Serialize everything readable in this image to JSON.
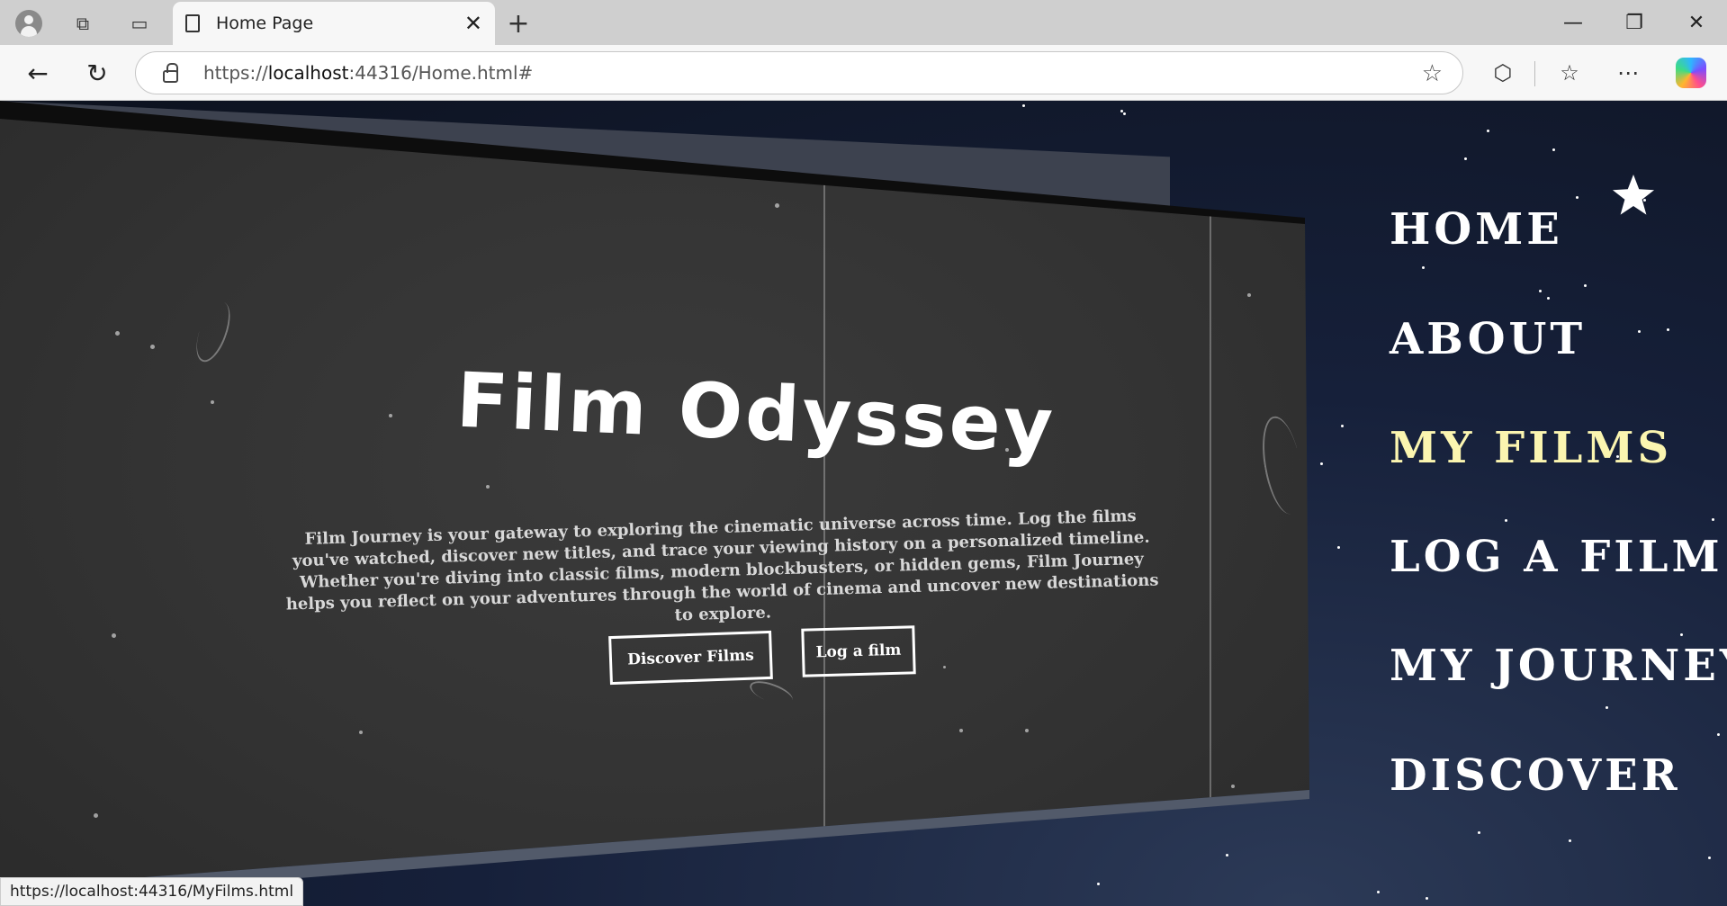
{
  "browser": {
    "tab_title": "Home Page",
    "url_prefix": "https://",
    "url_host": "localhost",
    "url_rest": ":44316/Home.html#",
    "status_url": "https://localhost:44316/MyFilms.html"
  },
  "hero": {
    "title": "Film Odyssey",
    "description": "Film Journey is your gateway to exploring the cinematic universe across time. Log the films you've watched, discover new titles, and trace your viewing history on a personalized timeline. Whether you're diving into classic films, modern blockbusters, or hidden gems, Film Journey helps you reflect on your adventures through the world of cinema and uncover new destinations to explore.",
    "discover_label": "Discover Films",
    "log_label": "Log a film"
  },
  "nav": {
    "items": [
      {
        "label": "HOME"
      },
      {
        "label": "ABOUT"
      },
      {
        "label": "MY FILMS"
      },
      {
        "label": "LOG A FILM"
      },
      {
        "label": "MY JOURNEY"
      },
      {
        "label": "DISCOVER"
      }
    ]
  },
  "colors": {
    "active_nav": "#fbf5b0",
    "screen": "#333333",
    "sky": "#0c111d"
  }
}
